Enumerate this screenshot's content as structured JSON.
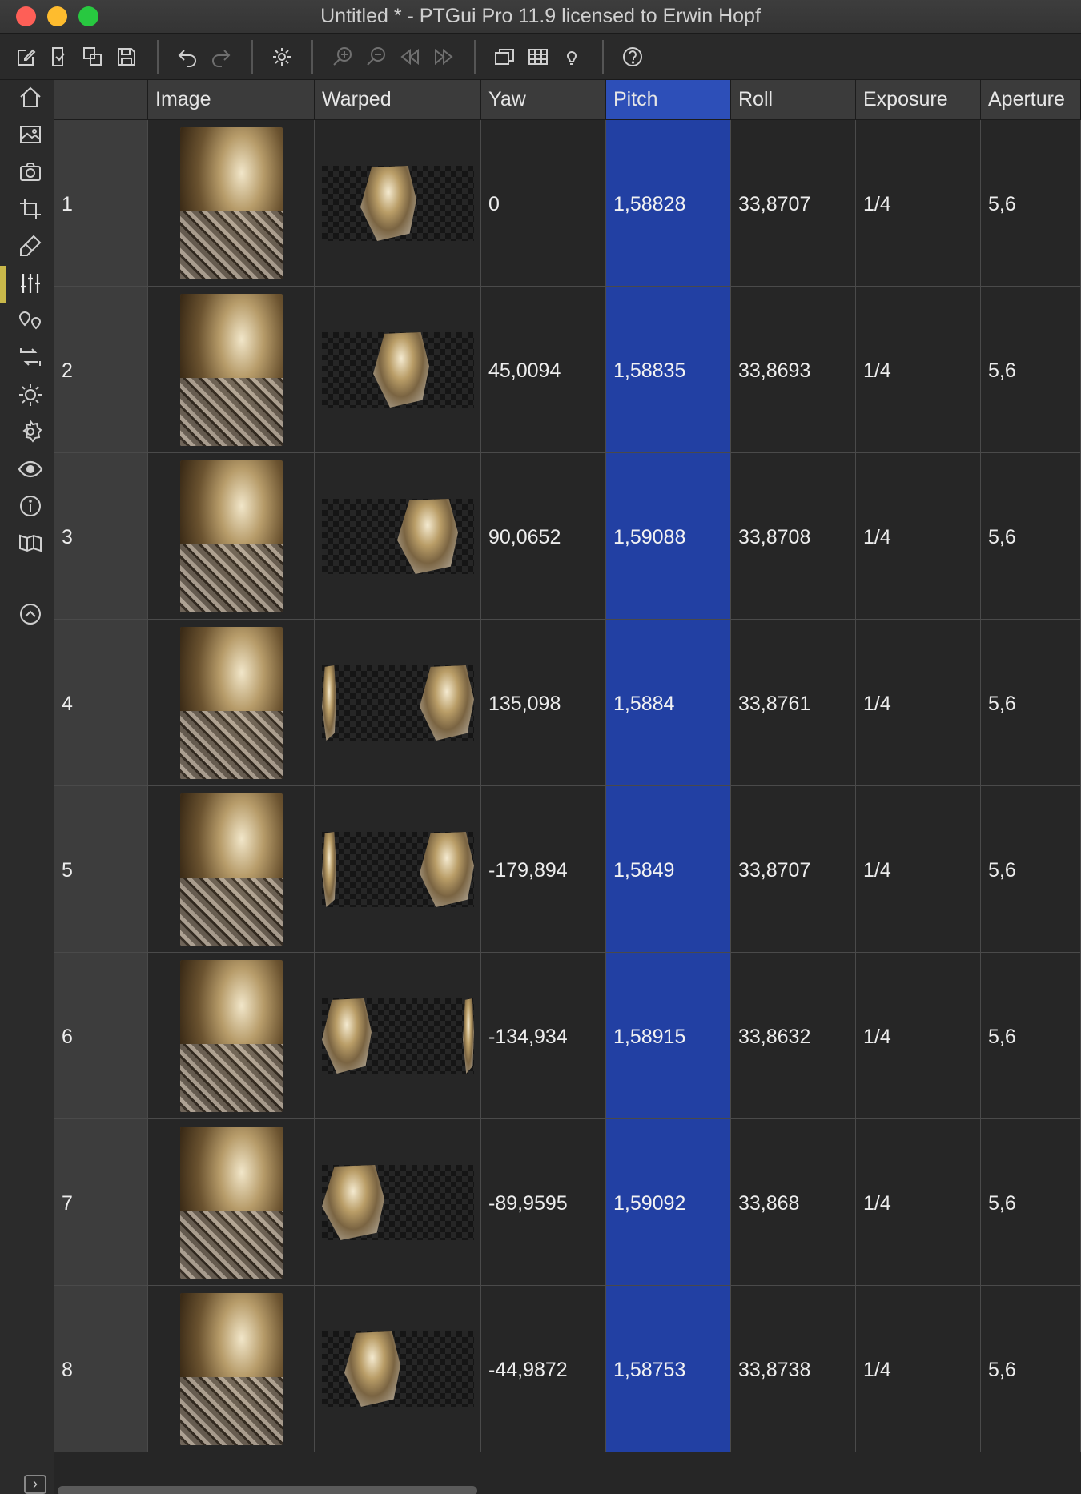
{
  "window": {
    "title": "Untitled * - PTGui Pro 11.9 licensed to Erwin Hopf"
  },
  "toolbar": {
    "icons": [
      "new-project-icon",
      "open-project-icon",
      "save-as-icon",
      "save-icon",
      "undo-icon",
      "redo-icon",
      "settings-icon",
      "zoom-in-icon",
      "zoom-out-icon",
      "previous-icon",
      "next-icon",
      "panorama-editor-icon",
      "control-points-table-icon",
      "lightbulb-icon",
      "help-icon"
    ]
  },
  "sidebar": {
    "items": [
      "home-icon",
      "images-icon",
      "camera-icon",
      "crop-icon",
      "mask-icon",
      "image-parameters-icon",
      "control-points-icon",
      "optimizer-icon",
      "exposure-hdr-icon",
      "project-settings-icon",
      "preview-icon",
      "project-info-icon",
      "create-panorama-icon",
      "collapse-icon"
    ],
    "active": "image-parameters-icon",
    "accent": "#c9b84a"
  },
  "table": {
    "columns": [
      "",
      "Image",
      "Warped",
      "Yaw",
      "Pitch",
      "Roll",
      "Exposure",
      "Aperture"
    ],
    "selected_column": "Pitch",
    "selected_color": "#2240a3",
    "rows": [
      {
        "index": "1",
        "yaw": "0",
        "pitch": "1,58828",
        "roll": "33,8707",
        "exposure": "1/4",
        "aperture": "5,6"
      },
      {
        "index": "2",
        "yaw": "45,0094",
        "pitch": "1,58835",
        "roll": "33,8693",
        "exposure": "1/4",
        "aperture": "5,6"
      },
      {
        "index": "3",
        "yaw": "90,0652",
        "pitch": "1,59088",
        "roll": "33,8708",
        "exposure": "1/4",
        "aperture": "5,6"
      },
      {
        "index": "4",
        "yaw": "135,098",
        "pitch": "1,5884",
        "roll": "33,8761",
        "exposure": "1/4",
        "aperture": "5,6"
      },
      {
        "index": "5",
        "yaw": "-179,894",
        "pitch": "1,5849",
        "roll": "33,8707",
        "exposure": "1/4",
        "aperture": "5,6"
      },
      {
        "index": "6",
        "yaw": "-134,934",
        "pitch": "1,58915",
        "roll": "33,8632",
        "exposure": "1/4",
        "aperture": "5,6"
      },
      {
        "index": "7",
        "yaw": "-89,9595",
        "pitch": "1,59092",
        "roll": "33,868",
        "exposure": "1/4",
        "aperture": "5,6"
      },
      {
        "index": "8",
        "yaw": "-44,9872",
        "pitch": "1,58753",
        "roll": "33,8738",
        "exposure": "1/4",
        "aperture": "5,6"
      }
    ]
  }
}
